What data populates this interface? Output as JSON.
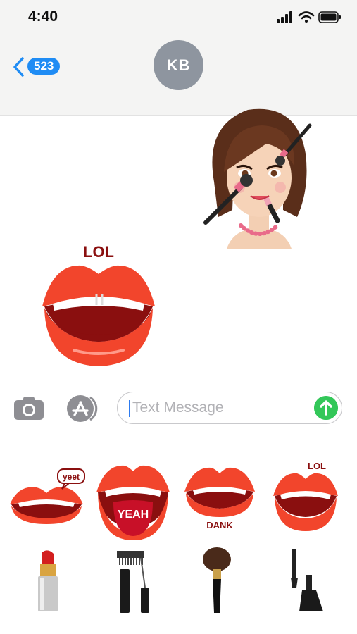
{
  "status_bar": {
    "time": "4:40",
    "icons": [
      "signal-icon",
      "wifi-icon",
      "battery-icon"
    ]
  },
  "header": {
    "back_count": "523",
    "contact_initials": "KB"
  },
  "conversation": {
    "stickers": [
      {
        "name": "makeup-girl-sticker"
      },
      {
        "name": "lips-sticker",
        "text": "LOL"
      }
    ]
  },
  "input_bar": {
    "placeholder": "Text Message",
    "camera_icon": "camera-icon",
    "apps_icon": "app-store-icon",
    "send_icon": "send-arrow-icon"
  },
  "drawer": {
    "lip_stickers": [
      {
        "name": "lips-yeet",
        "text": "yeet"
      },
      {
        "name": "lips-yeah",
        "text": "YEAH"
      },
      {
        "name": "lips-dank",
        "text": "DANK"
      },
      {
        "name": "lips-lol",
        "text": "LOL"
      }
    ],
    "tool_stickers": [
      {
        "name": "lipstick"
      },
      {
        "name": "mascara"
      },
      {
        "name": "makeup-brush"
      },
      {
        "name": "nail-polish"
      }
    ]
  },
  "colors": {
    "lip_red": "#f2452c",
    "mouth_dark": "#8a0f0f",
    "ios_blue": "#1f8cf4",
    "send_green": "#33c759",
    "header_bg": "#f4f4f3"
  }
}
